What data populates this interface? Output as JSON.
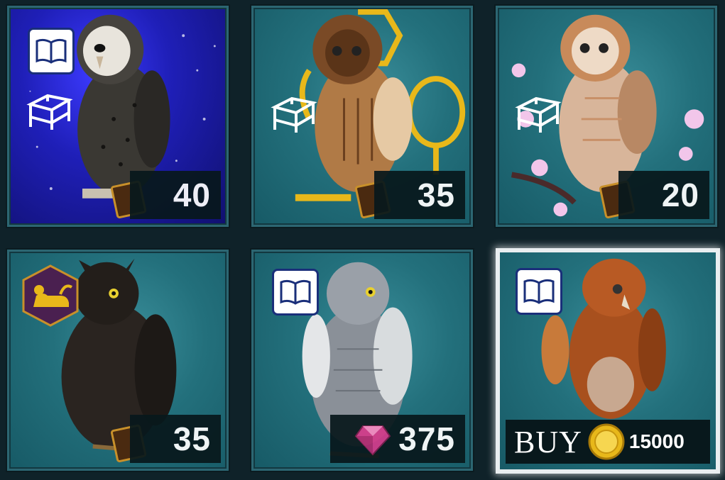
{
  "shop": {
    "items": [
      {
        "name": "owl-barn-dark",
        "price": "40",
        "badges": [
          "book",
          "furniture"
        ]
      },
      {
        "name": "owl-short-eared",
        "price": "35",
        "badges": [
          "furniture"
        ]
      },
      {
        "name": "owl-tawny-blossom",
        "price": "20",
        "badges": [
          "furniture"
        ]
      },
      {
        "name": "owl-black-eagle",
        "price": "35",
        "badges": [
          "sphinx"
        ]
      },
      {
        "name": "owl-grey",
        "price": "375",
        "badges": [
          "book"
        ],
        "currency": "gem"
      },
      {
        "name": "owl-rufous",
        "buy_label": "BUY",
        "price": "15000",
        "badges": [
          "book"
        ],
        "currency": "coin",
        "selected": true
      }
    ]
  },
  "colors": {
    "card_bg": "#23707c",
    "night_bg": "#1f1fb8",
    "price_bar": "#08181c",
    "book_border": "#1a2f7a",
    "coin": "#e8b81a",
    "gem": "#d23a8a"
  }
}
